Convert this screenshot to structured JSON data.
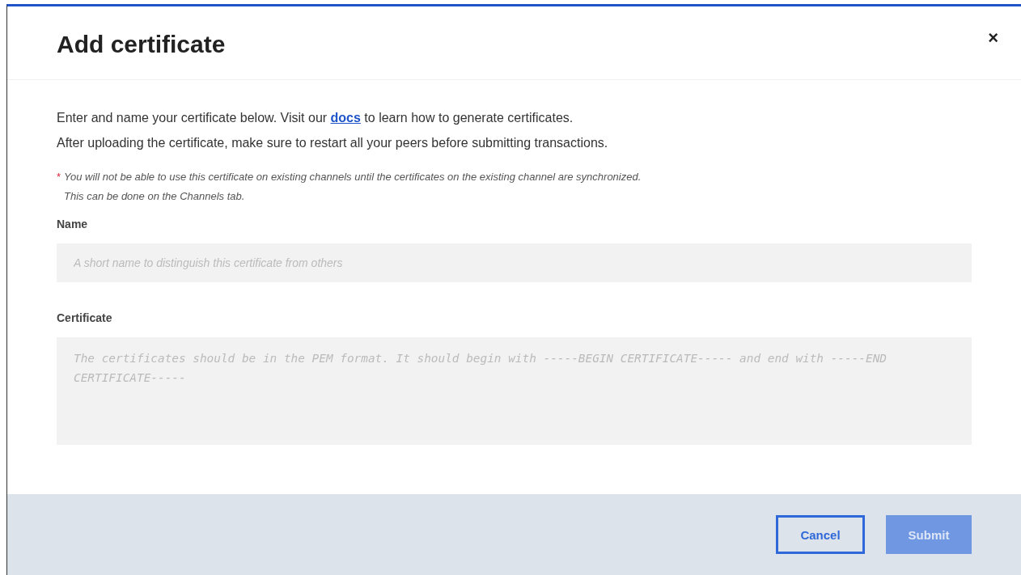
{
  "dialog": {
    "title": "Add certificate",
    "close": "×",
    "intro": {
      "before": "Enter and name your certificate below. Visit our ",
      "link": "docs",
      "after": " to learn how to generate certificates."
    },
    "intro_2": "After uploading the certificate, make sure to restart all your peers before submitting transactions.",
    "note": {
      "marker": "*",
      "text": "You will not be able to use this certificate on existing channels until the certificates on the existing channel are synchronized. This can be done on the Channels tab."
    },
    "fields": [
      {
        "kind": "input",
        "label": "Name",
        "placeholder": "A short name to distinguish this certificate from others"
      },
      {
        "kind": "textarea",
        "label": "Certificate",
        "placeholder": "The certificates should be in the PEM format. It should begin with -----BEGIN CERTIFICATE----- and end with -----END CERTIFICATE-----"
      }
    ],
    "buttons": [
      {
        "kind": "secondary",
        "label": "Cancel",
        "disabled": false
      },
      {
        "kind": "primary",
        "label": "Submit",
        "disabled": true
      }
    ]
  }
}
